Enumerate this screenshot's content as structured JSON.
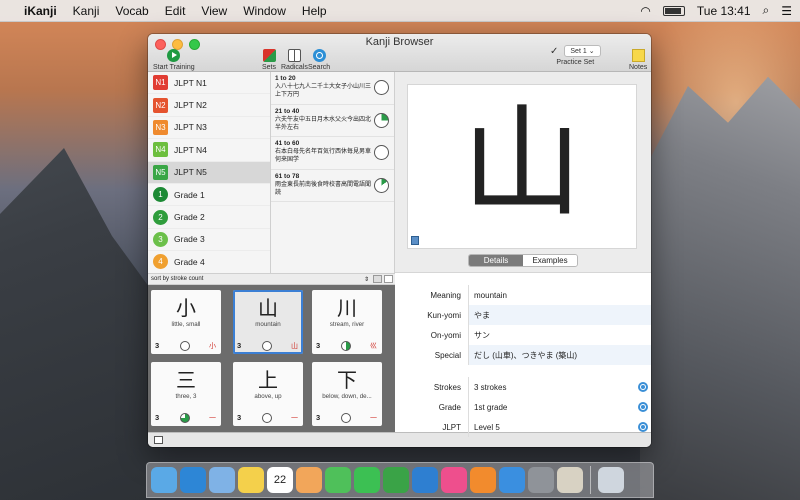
{
  "menubar": {
    "app_name": "iKanji",
    "menus": [
      "Kanji",
      "Vocab",
      "Edit",
      "View",
      "Window",
      "Help"
    ],
    "time": "Tue 13:41"
  },
  "window": {
    "title": "Kanji Browser",
    "toolbar": {
      "start_training": "Start Training",
      "sets": "Sets",
      "radicals": "Radicals",
      "search": "Search",
      "practice_set_label": "Practice Set",
      "practice_set_value": "Set 1",
      "notes": "Notes"
    }
  },
  "sets": [
    {
      "badge": "N1",
      "label": "JLPT N1",
      "color": "#e13c33"
    },
    {
      "badge": "N2",
      "label": "JLPT N2",
      "color": "#e5532f"
    },
    {
      "badge": "N3",
      "label": "JLPT N3",
      "color": "#ef8a2e"
    },
    {
      "badge": "N4",
      "label": "JLPT N4",
      "color": "#6dbf3e"
    },
    {
      "badge": "N5",
      "label": "JLPT N5",
      "color": "#3aa646"
    },
    {
      "badge": "1",
      "label": "Grade 1",
      "color": "#1d8a35"
    },
    {
      "badge": "2",
      "label": "Grade 2",
      "color": "#2f9d3c"
    },
    {
      "badge": "3",
      "label": "Grade 3",
      "color": "#6cc04a"
    },
    {
      "badge": "4",
      "label": "Grade 4",
      "color": "#f0a030"
    }
  ],
  "ranges": [
    {
      "title": "1 to 20",
      "kanji": "入八十七九人二千土大女子小山川三上下万円",
      "progress": "empty"
    },
    {
      "title": "21 to 40",
      "kanji": "六夫午友中五日月木水父火今出四北半外左右",
      "progress": "p1"
    },
    {
      "title": "41 to 60",
      "kanji": "右本白母先名年百気行西休毎見男車何来国学",
      "progress": "empty"
    },
    {
      "title": "61 to 78",
      "kanji": "雨金東長前南後食時校書高間電語聞読",
      "progress": "p2"
    }
  ],
  "sort": {
    "label": "sort by stroke count"
  },
  "cards": [
    {
      "kanji": "小",
      "meaning": "little, small",
      "strokes": "3",
      "radical": "小",
      "progress": "empty",
      "selected": false
    },
    {
      "kanji": "山",
      "meaning": "mountain",
      "strokes": "3",
      "radical": "山",
      "progress": "empty",
      "selected": true
    },
    {
      "kanji": "川",
      "meaning": "stream, river",
      "strokes": "3",
      "radical": "巛",
      "progress": "half",
      "selected": false
    },
    {
      "kanji": "三",
      "meaning": "three, 3",
      "strokes": "3",
      "radical": "一",
      "progress": "three",
      "selected": false
    },
    {
      "kanji": "上",
      "meaning": "above, up",
      "strokes": "3",
      "radical": "一",
      "progress": "empty",
      "selected": false
    },
    {
      "kanji": "下",
      "meaning": "below, down, de...",
      "strokes": "3",
      "radical": "一",
      "progress": "empty",
      "selected": false
    }
  ],
  "detail": {
    "big_kanji": "山",
    "tabs": [
      "Details",
      "Examples"
    ],
    "active_tab": "Details",
    "rows": [
      {
        "label": "Meaning",
        "value": "mountain",
        "alt": false,
        "zoom": false
      },
      {
        "label": "Kun-yomi",
        "value": "やま",
        "alt": true,
        "zoom": false
      },
      {
        "label": "On-yomi",
        "value": "サン",
        "alt": false,
        "zoom": false
      },
      {
        "label": "Special",
        "value": "だし (山車)、つきやま (築山)",
        "alt": true,
        "zoom": false
      },
      {
        "label": "Strokes",
        "value": "3 strokes",
        "alt": false,
        "zoom": true
      },
      {
        "label": "Grade",
        "value": "1st grade",
        "alt": false,
        "zoom": true
      },
      {
        "label": "JLPT",
        "value": "Level 5",
        "alt": false,
        "zoom": true
      }
    ]
  },
  "dock": {
    "icons": [
      "finder-icon",
      "safari-icon",
      "mail-icon",
      "notes-icon",
      "calendar-icon",
      "photos-icon",
      "messages-icon",
      "facetime-icon",
      "numbers-icon",
      "keynote-icon",
      "itunes-icon",
      "ibooks-icon",
      "appstore-icon",
      "settings-icon",
      "ikanji-icon",
      "trash-icon"
    ],
    "colors": [
      "#5aa9e6",
      "#2d86d6",
      "#7fb2e6",
      "#f4d04b",
      "#ffffff",
      "#f2a65a",
      "#4fc05a",
      "#3cc053",
      "#3aa347",
      "#2e7fd1",
      "#ee4f8d",
      "#f28b2d",
      "#3a8fe0",
      "#8f9399",
      "#d8d2c3",
      "#cfd6de"
    ],
    "calendar_date": "22"
  }
}
